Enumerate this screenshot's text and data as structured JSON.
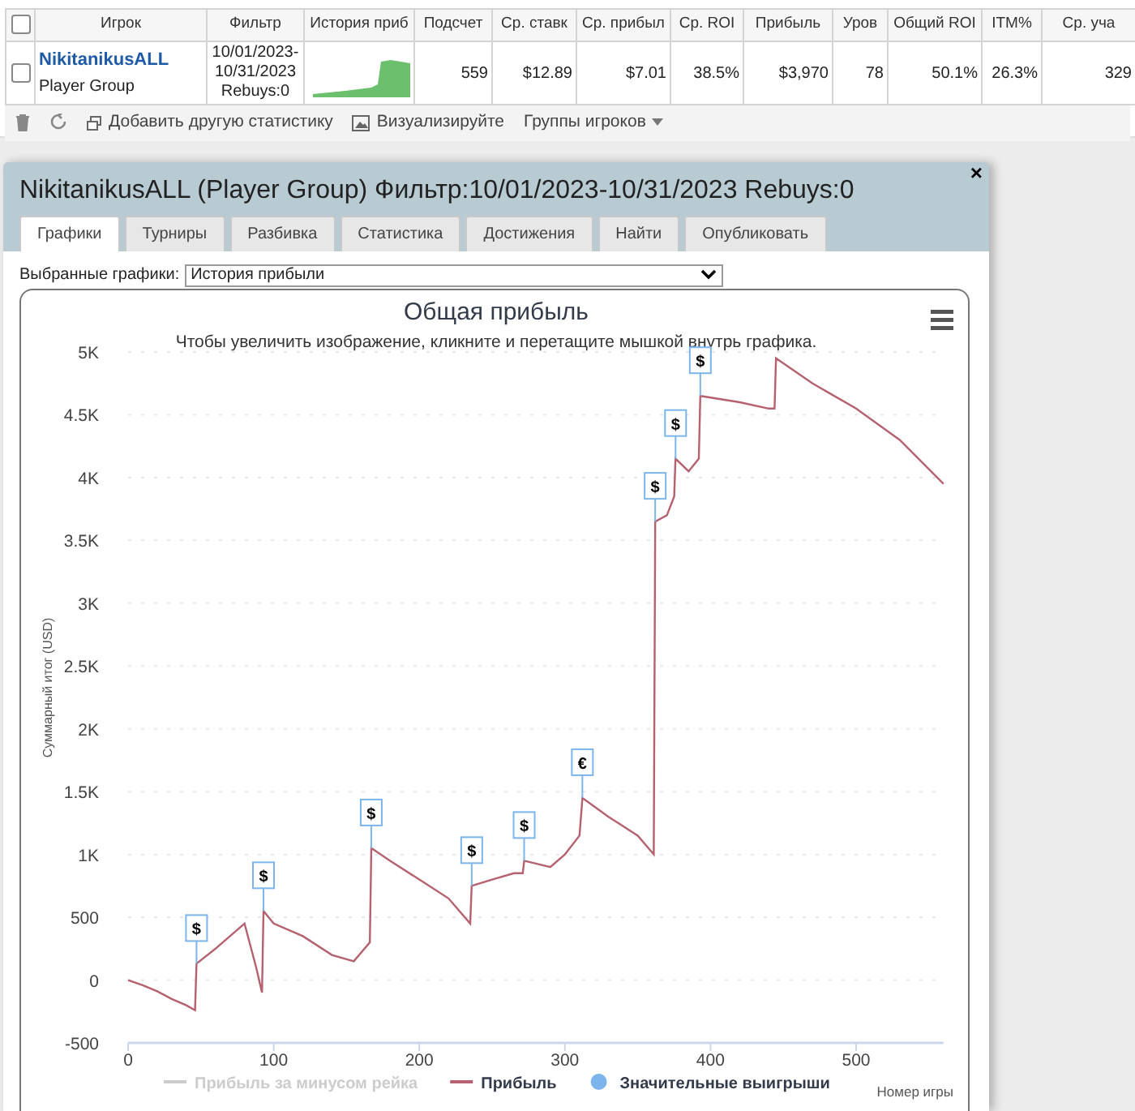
{
  "stats_table": {
    "header_checked": false,
    "columns": [
      "Игрок",
      "Фильтр",
      "История приб",
      "Подсчет",
      "Ср. ставк",
      "Ср. прибыл",
      "Ср. ROI",
      "Прибыль",
      "Уров",
      "Общий ROI",
      "ITM%",
      "Ср. уча"
    ],
    "rows": [
      {
        "checked": false,
        "cells": [
          [
            "NikitanikusALL",
            "Player Group"
          ],
          [
            "10/01/2023-",
            "10/31/2023",
            "Rebuys:0"
          ],
          "",
          "559",
          "$12.89",
          "$7.01",
          "38.5%",
          "$3,970",
          "78",
          "50.1%",
          "26.3%",
          "329"
        ]
      }
    ]
  },
  "toolbar": [
    {
      "kind": "delete"
    },
    {
      "kind": "refresh"
    },
    {
      "kind": "add",
      "label": "Добавить другую статистику"
    },
    {
      "kind": "visualize",
      "label": "Визуализируйте"
    },
    {
      "kind": "dropdown",
      "label": "Группы игроков"
    }
  ],
  "dialog": {
    "title": "NikitanikusALL (Player Group) Фильтр:10/01/2023-10/31/2023 Rebuys:0",
    "close": "×",
    "tabs": [
      {
        "label": "Графики",
        "selected": true
      },
      {
        "label": "Турниры",
        "selected": false
      },
      {
        "label": "Разбивка",
        "selected": false
      },
      {
        "label": "Статистика",
        "selected": false
      },
      {
        "label": "Достижения",
        "selected": false
      },
      {
        "label": "Найти",
        "selected": false
      },
      {
        "label": "Опубликовать",
        "selected": false
      }
    ],
    "chart_select": {
      "label": "Выбранные графики:",
      "value": "История прибыли"
    },
    "chart": {
      "subtitle": "Чтобы увеличить изображение, кликните и перетащите мышкой внутрь графика.",
      "legend": [
        {
          "label": "Прибыль за минусом рейка",
          "kind": "line",
          "visible": false,
          "color": "#cccccc"
        },
        {
          "kind": "series",
          "visible": true
        },
        {
          "label": "Значительные выигрыши",
          "kind": "marker",
          "visible": true,
          "color": "#7cb5ec"
        }
      ],
      "chart_data": {
        "type": "line",
        "title": "Общая прибыль",
        "xlabel": "Номер игры",
        "ylabel": "Суммарный итог (USD)",
        "grid": true,
        "x": [
          0,
          10,
          20,
          30,
          40,
          46,
          47,
          60,
          80,
          88,
          92,
          93,
          100,
          120,
          140,
          155,
          166,
          167,
          180,
          200,
          220,
          235,
          236,
          250,
          265,
          271,
          272,
          290,
          300,
          310,
          312,
          330,
          350,
          361,
          362,
          370,
          375,
          376,
          385,
          392,
          393,
          420,
          440,
          444,
          445,
          470,
          500,
          530,
          560
        ],
        "series": [
          {
            "name": "Прибыль",
            "color": "#b5616f",
            "values": [
              0,
              -40,
              -90,
              -150,
              -200,
              -240,
              130,
              250,
              450,
              100,
              -100,
              550,
              450,
              350,
              200,
              150,
              300,
              1050,
              950,
              800,
              650,
              450,
              750,
              800,
              850,
              850,
              950,
              900,
              1000,
              1150,
              1450,
              1300,
              1150,
              1000,
              3650,
              3700,
              3850,
              4150,
              4050,
              4150,
              4650,
              4600,
              4550,
              4550,
              4950,
              4750,
              4550,
              4300,
              3950
            ]
          }
        ],
        "xlim": [
          0,
          560
        ],
        "ylim": [
          -500,
          5000
        ],
        "xticks": [
          0,
          100,
          200,
          300,
          400,
          500
        ],
        "yticks": [
          {
            "value": -500,
            "label": "-500"
          },
          {
            "value": 0,
            "label": "0"
          },
          {
            "value": 500,
            "label": "500"
          },
          {
            "value": 1000,
            "label": "1K"
          },
          {
            "value": 1500,
            "label": "1.5K"
          },
          {
            "value": 2000,
            "label": "2K"
          },
          {
            "value": 2500,
            "label": "2.5K"
          },
          {
            "value": 3000,
            "label": "3K"
          },
          {
            "value": 3500,
            "label": "3.5K"
          },
          {
            "value": 4000,
            "label": "4K"
          },
          {
            "value": 4500,
            "label": "4.5K"
          },
          {
            "value": 5000,
            "label": "5K"
          }
        ],
        "annotations": [
          {
            "x": 47,
            "y": 130,
            "text": "$"
          },
          {
            "x": 93,
            "y": 550,
            "text": "$"
          },
          {
            "x": 167,
            "y": 1050,
            "text": "$"
          },
          {
            "x": 236,
            "y": 750,
            "text": "$"
          },
          {
            "x": 272,
            "y": 950,
            "text": "$"
          },
          {
            "x": 312,
            "y": 1450,
            "text": "€"
          },
          {
            "x": 362,
            "y": 3650,
            "text": "$"
          },
          {
            "x": 376,
            "y": 4150,
            "text": "$"
          },
          {
            "x": 393,
            "y": 4650,
            "text": "$"
          }
        ]
      }
    }
  }
}
